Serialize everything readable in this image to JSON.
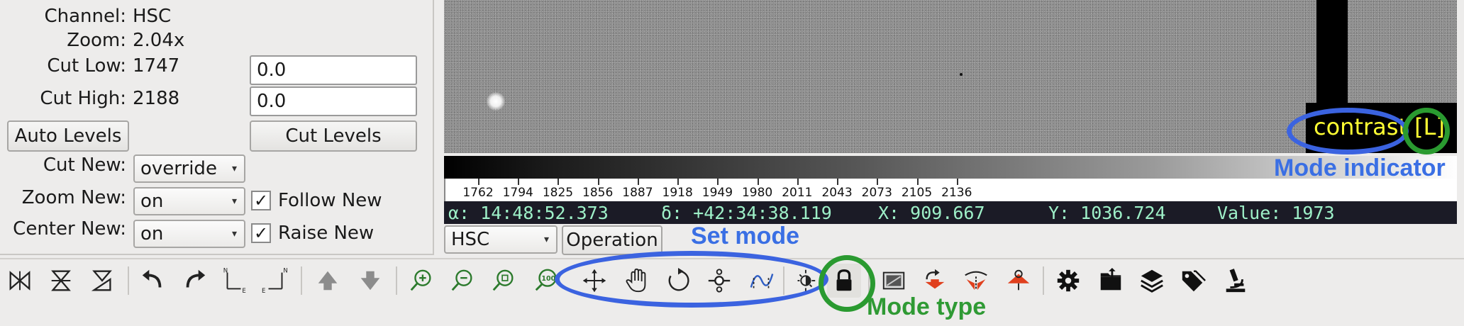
{
  "info": {
    "channel_label": "Channel:",
    "channel_value": "HSC",
    "zoom_label": "Zoom:",
    "zoom_value": "2.04x",
    "cut_low_label": "Cut Low:",
    "cut_low_value": "1747",
    "cut_low_entry": "0.0",
    "cut_high_label": "Cut High:",
    "cut_high_value": "2188",
    "cut_high_entry": "0.0",
    "auto_levels": "Auto Levels",
    "cut_levels": "Cut Levels",
    "cut_new_label": "Cut New:",
    "cut_new_value": "override",
    "zoom_new_label": "Zoom New:",
    "zoom_new_value": "on",
    "follow_new": "Follow New",
    "center_new_label": "Center New:",
    "center_new_value": "on",
    "raise_new": "Raise New"
  },
  "viewer": {
    "mode_indicator_text": "contrast [L]"
  },
  "colorbar": {
    "ticks": [
      "1762",
      "1794",
      "1825",
      "1856",
      "1887",
      "1918",
      "1949",
      "1980",
      "2011",
      "2043",
      "2073",
      "2105",
      "2136"
    ]
  },
  "readout": {
    "ra": "α: 14:48:52.373",
    "dec": "δ: +42:34:38.119",
    "x": "X: 909.667",
    "y": "Y: 1036.724",
    "value": "Value: 1973"
  },
  "bottom": {
    "channel_select": "HSC",
    "operation": "Operation"
  },
  "annotations": {
    "mode_indicator": "Mode indicator",
    "set_mode": "Set mode",
    "mode_type": "Mode type"
  },
  "toolbar_icons": [
    "flip-x-icon",
    "flip-y-icon",
    "swap-xy-icon",
    "rotate-left-icon",
    "rotate-right-icon",
    "orient-ne-icon",
    "orient-en-icon",
    "prev-image-icon",
    "next-image-icon",
    "zoom-in-icon",
    "zoom-out-icon",
    "zoom-fit-icon",
    "zoom-100-icon",
    "pan-mode-icon",
    "freepan-mode-icon",
    "rotate-mode-icon",
    "dist-mode-icon",
    "cmap-mode-icon",
    "contrast-mode-icon",
    "lock-mode-icon",
    "auto-cuts-icon",
    "center-image-icon",
    "zoom-fit-red-icon",
    "auto-pan-icon",
    "settings-icon",
    "open-file-icon",
    "layers-icon",
    "tags-icon",
    "microscope-icon"
  ],
  "colors": {
    "annotation_blue": "#3b63e0",
    "annotation_green": "#2a9a30",
    "mode_text": "#ffff33",
    "readout_text": "#9ef0c8",
    "readout_bg": "#1b1b26"
  }
}
